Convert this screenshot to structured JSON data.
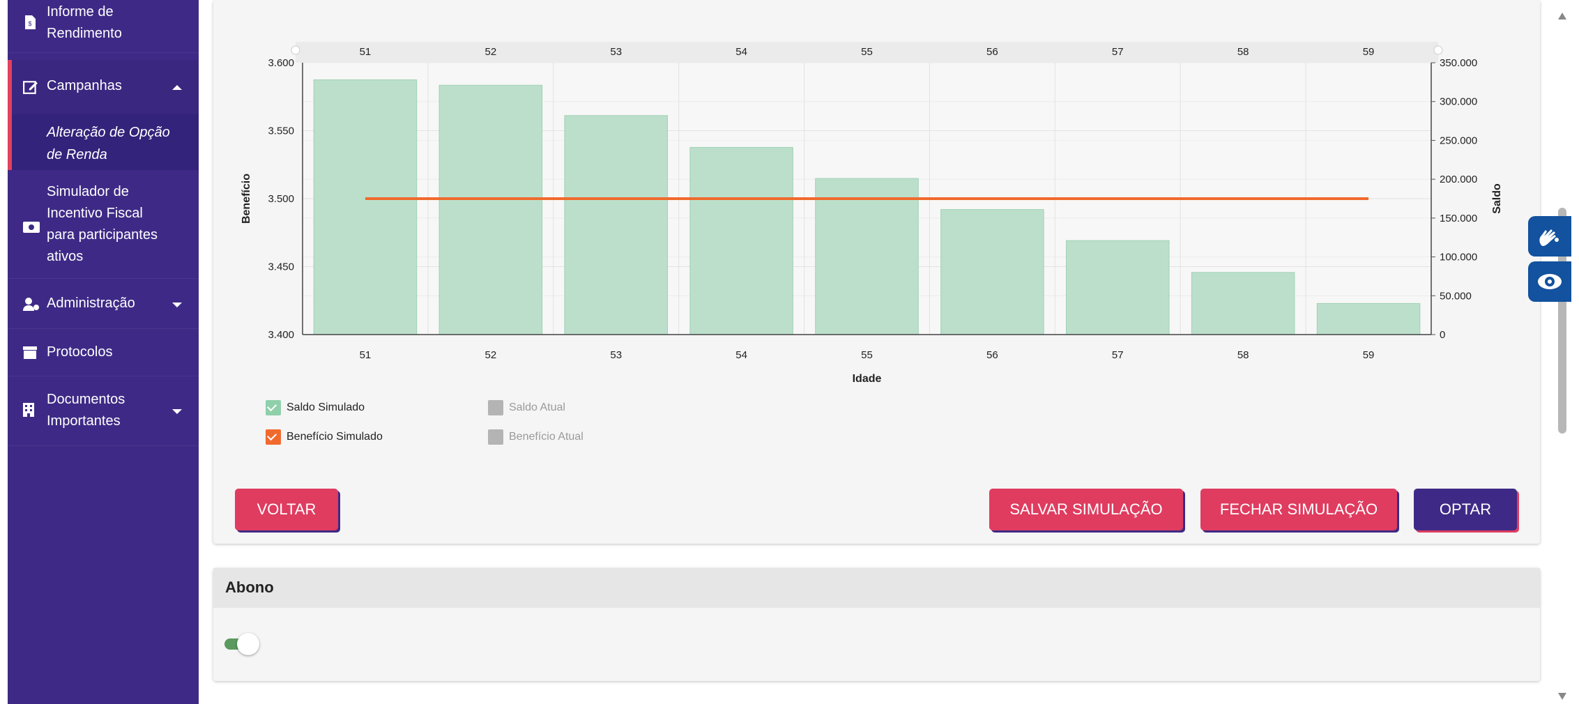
{
  "sidebar": {
    "items": [
      {
        "label_lines": [
          "Informe de",
          "Rendimento"
        ],
        "icon": "file-dollar-icon"
      },
      {
        "label": "Campanhas",
        "icon": "edit-icon",
        "expanded": true
      },
      {
        "label_lines": [
          "Alteração de Opção",
          "de Renda"
        ]
      },
      {
        "label_lines": [
          "Simulador de",
          "Incentivo Fiscal",
          "para participantes",
          "ativos"
        ],
        "icon": "money-icon"
      },
      {
        "label": "Administração",
        "icon": "users-gear-icon"
      },
      {
        "label": "Protocolos",
        "icon": "archive-icon"
      },
      {
        "label_lines": [
          "Documentos",
          "Importantes"
        ],
        "icon": "building-icon"
      }
    ]
  },
  "chart_data": {
    "type": "bar",
    "categories": [
      "51",
      "52",
      "53",
      "54",
      "55",
      "56",
      "57",
      "58",
      "59"
    ],
    "xlabel": "Idade",
    "ylabel_left": "Benefício",
    "ylabel_right": "Saldo",
    "ylim_left": [
      3400,
      3600
    ],
    "ylim_right": [
      0,
      350000
    ],
    "left_ticks": [
      "3.400",
      "3.450",
      "3.500",
      "3.550",
      "3.600"
    ],
    "right_ticks": [
      "0",
      "50.000",
      "100.000",
      "150.000",
      "200.000",
      "250.000",
      "300.000",
      "350.000"
    ],
    "series": [
      {
        "name": "Saldo Simulado",
        "kind": "bar",
        "axis": "right",
        "values": [
          328000,
          321000,
          282000,
          241000,
          201000,
          161000,
          121000,
          80000,
          40000
        ]
      },
      {
        "name": "Benefício Simulado",
        "kind": "line",
        "axis": "left",
        "values": [
          3500,
          3500,
          3500,
          3500,
          3500,
          3500,
          3500,
          3500,
          3500
        ]
      }
    ],
    "legend": [
      {
        "label": "Saldo Simulado",
        "checked": true
      },
      {
        "label": "Saldo Atual",
        "checked": false
      },
      {
        "label": "Benefício Simulado",
        "checked": true
      },
      {
        "label": "Benefício Atual",
        "checked": false
      }
    ],
    "colors": {
      "bar": "#bcdfcc",
      "bar_stroke": "#9ed2b4",
      "line": "#f06a2e",
      "inactive": "#b4b4b4"
    },
    "grid": true
  },
  "buttons": {
    "back": "VOLTAR",
    "save": "SALVAR SIMULAÇÃO",
    "close": "FECHAR SIMULAÇÃO",
    "opt": "OPTAR"
  },
  "abono": {
    "title": "Abono",
    "toggle_on": true
  },
  "colors": {
    "sidebar": "#3e2a86",
    "accent_red": "#df3c60",
    "a11y_blue": "#12529e"
  }
}
